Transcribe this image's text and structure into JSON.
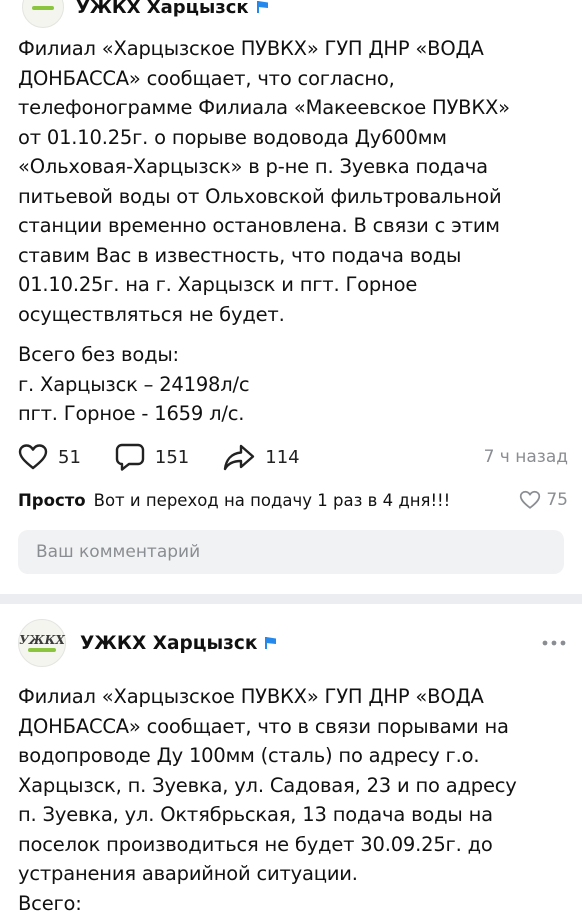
{
  "post1": {
    "author_name": "УЖКХ Харцызск",
    "paragraph1_lines": [
      "Филиал «Харцызское ПУВКХ» ГУП ДНР «ВОДА",
      "ДОНБАССА» сообщает, что согласно,",
      "телефонограмме Филиала «Макеевское ПУВКХ»",
      "от 01.10.25г. о порыве водовода Ду600мм",
      "«Ольховая-Харцызск» в р-не п. Зуевка подача",
      "питьевой воды от Ольховской фильтровальной",
      "станции временно остановлена. В связи с этим",
      "ставим Вас в известность, что подача воды",
      "01.10.25г. на г. Харцызск и пгт. Горное",
      "осуществляться не будет."
    ],
    "paragraph2_lines": [
      "Всего без воды:",
      "г. Харцызск – 24198л/с",
      "пгт. Горное - 1659 л/с."
    ],
    "likes": "51",
    "comments": "151",
    "reposts": "114",
    "time": "7 ч назад"
  },
  "top_comment": {
    "author": "Просто",
    "text": "Вот и переход на подачу 1 раз в 4 дня!!!",
    "likes": "75"
  },
  "comment_input": {
    "placeholder": "Ваш комментарий"
  },
  "post2": {
    "author_name": "УЖКХ Харцызск",
    "avatar_text": "УЖКХ",
    "paragraph1_lines": [
      "Филиал «Харцызское ПУВКХ» ГУП ДНР «ВОДА",
      "ДОНБАССА» сообщает, что в связи порывами на",
      "водопроводе Ду 100мм (сталь) по адресу г.о.",
      "Харцызск, п. Зуевка, ул. Садовая, 23 и по адресу",
      "п. Зуевка, ул. Октябрьская, 13 подача воды на",
      "поселок производиться не будет 30.09.25г. до",
      "устранения аварийной ситуации.",
      "Всего:"
    ]
  },
  "colors": {
    "accent_blue": "#2688eb",
    "logo_green": "#8bc53f",
    "muted_gray": "#8a8d91",
    "input_bg": "#f1f2f4",
    "separator": "#ebedf0"
  },
  "icons": {
    "like": "heart-icon",
    "comment": "speech-bubble-icon",
    "share": "share-arrow-icon",
    "verified": "flag-icon",
    "menu": "more-dots-icon"
  }
}
